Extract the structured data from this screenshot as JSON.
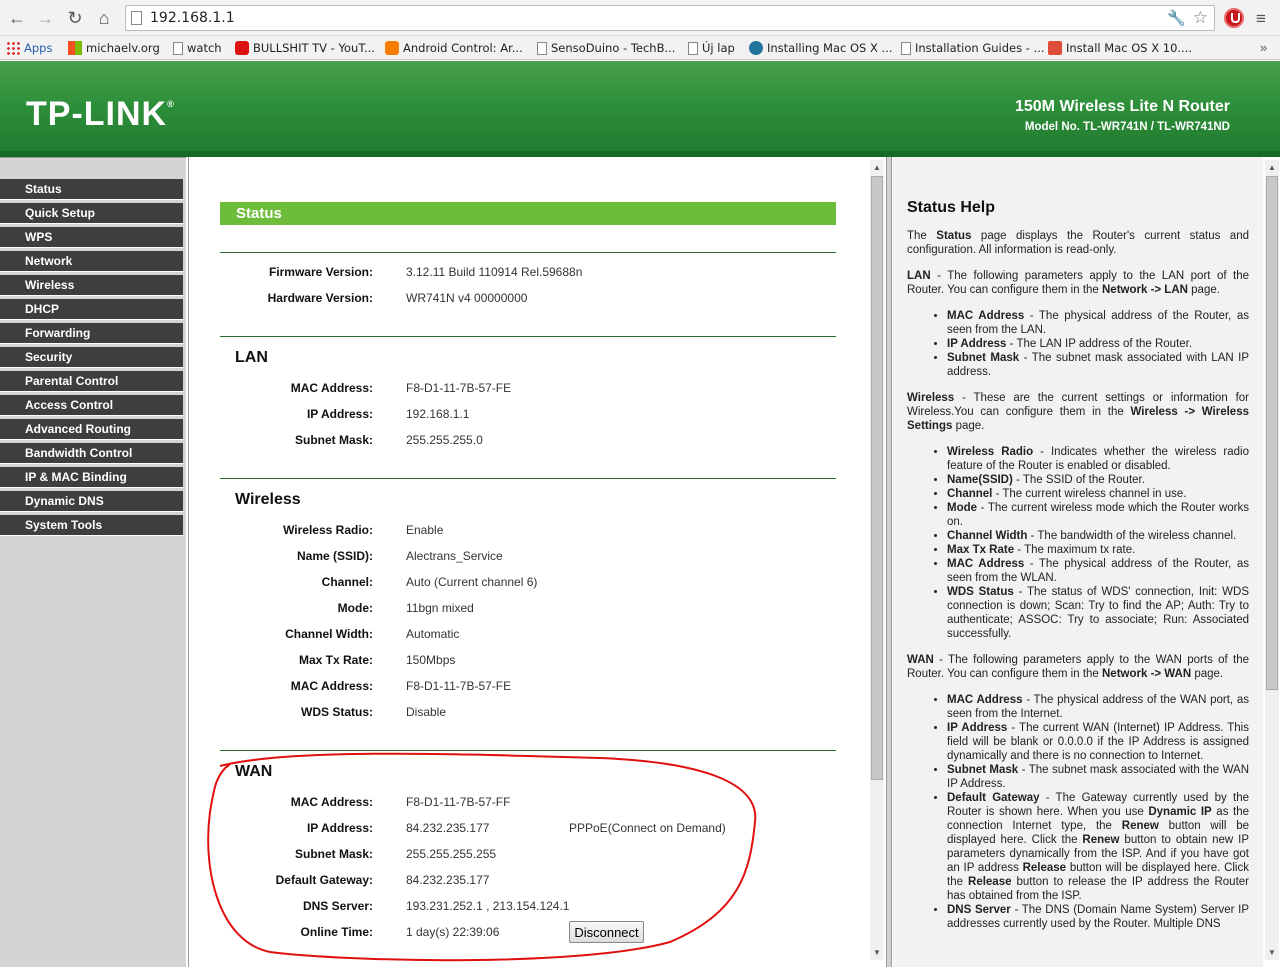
{
  "browser": {
    "url": "192.168.1.1",
    "bookmarks": [
      "Apps",
      "michaelv.org",
      "watch",
      "BULLSHIT TV - YouT...",
      "Android Control: Ar...",
      "SensoDuino - TechB...",
      "Új lap",
      "Installing Mac OS X ...",
      "Installation Guides - ...",
      "Install Mac OS X 10...."
    ],
    "bookmark_more": "»"
  },
  "header": {
    "logo": "TP-LINK",
    "logo_mark": "®",
    "product": "150M Wireless Lite N Router",
    "model": "Model No. TL-WR741N / TL-WR741ND"
  },
  "sidebar": {
    "items": [
      "Status",
      "Quick Setup",
      "WPS",
      "Network",
      "Wireless",
      "DHCP",
      "Forwarding",
      "Security",
      "Parental Control",
      "Access Control",
      "Advanced Routing",
      "Bandwidth Control",
      "IP & MAC Binding",
      "Dynamic DNS",
      "System Tools"
    ]
  },
  "status": {
    "title": "Status",
    "firmware_label": "Firmware Version:",
    "firmware_value": "3.12.11 Build 110914 Rel.59688n",
    "hardware_label": "Hardware Version:",
    "hardware_value": "WR741N v4 00000000",
    "lan": {
      "title": "LAN",
      "mac_label": "MAC Address:",
      "mac_value": "F8-D1-11-7B-57-FE",
      "ip_label": "IP Address:",
      "ip_value": "192.168.1.1",
      "mask_label": "Subnet Mask:",
      "mask_value": "255.255.255.0"
    },
    "wireless": {
      "title": "Wireless",
      "radio_label": "Wireless Radio:",
      "radio_value": "Enable",
      "ssid_label": "Name (SSID):",
      "ssid_value": "Alectrans_Service",
      "channel_label": "Channel:",
      "channel_value": "Auto (Current channel 6)",
      "mode_label": "Mode:",
      "mode_value": "11bgn mixed",
      "width_label": "Channel Width:",
      "width_value": "Automatic",
      "rate_label": "Max Tx Rate:",
      "rate_value": "150Mbps",
      "mac_label": "MAC Address:",
      "mac_value": "F8-D1-11-7B-57-FE",
      "wds_label": "WDS Status:",
      "wds_value": "Disable"
    },
    "wan": {
      "title": "WAN",
      "mac_label": "MAC Address:",
      "mac_value": "F8-D1-11-7B-57-FF",
      "ip_label": "IP Address:",
      "ip_value": "84.232.235.177",
      "connection_type": "PPPoE(Connect on Demand)",
      "mask_label": "Subnet Mask:",
      "mask_value": "255.255.255.255",
      "gateway_label": "Default Gateway:",
      "gateway_value": "84.232.235.177",
      "dns_label": "DNS Server:",
      "dns_value": "193.231.252.1 , 213.154.124.1",
      "online_label": "Online Time:",
      "online_value": "1 day(s) 22:39:06",
      "disconnect_label": "Disconnect"
    }
  },
  "help": {
    "title": "Status Help"
  },
  "colors": {
    "header_green": "#2e8f3a",
    "status_bar_green": "#6ebd3a",
    "sidebar_item": "#3e3e3e",
    "annotation_red": "#e01010"
  }
}
